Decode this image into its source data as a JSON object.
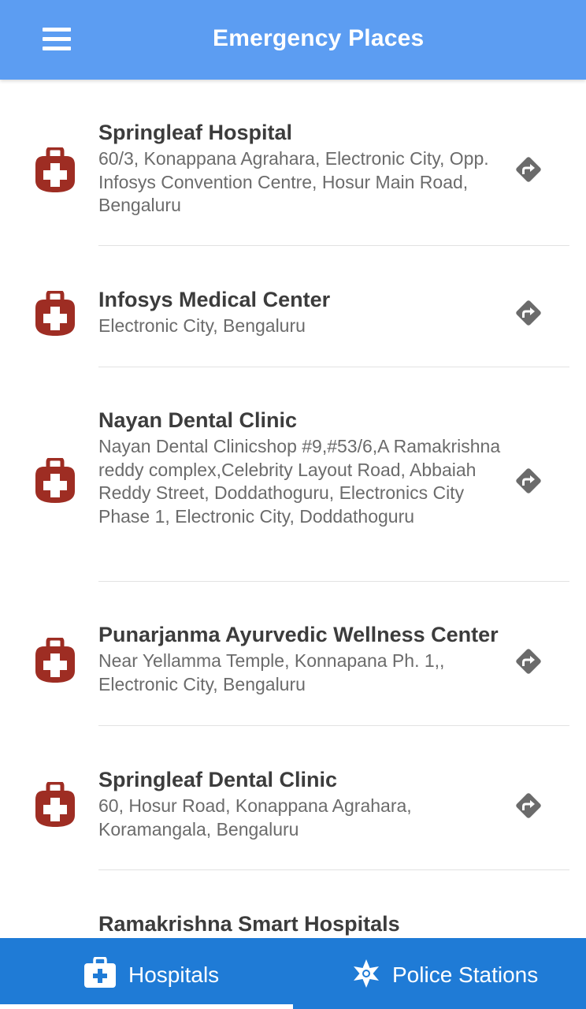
{
  "header": {
    "title": "Emergency Places",
    "menu_icon": "hamburger-menu-icon",
    "background_color": "#5c9df2"
  },
  "places": [
    {
      "name": "Springleaf Hospital",
      "address": "60/3, Konappana Agrahara, Electronic City, Opp. Infosys Convention Centre, Hosur Main Road, Bengaluru",
      "icon": "hospital-icon",
      "action_icon": "directions-icon"
    },
    {
      "name": "Infosys Medical Center",
      "address": "Electronic City, Bengaluru",
      "icon": "hospital-icon",
      "action_icon": "directions-icon"
    },
    {
      "name": "Nayan Dental Clinic",
      "address": "Nayan Dental Clinicshop #9,#53/6,A Ramakrishna reddy complex,Celebrity Layout Road, Abbaiah Reddy Street, Doddathoguru, Electronics City Phase 1, Electronic City, Doddathoguru",
      "icon": "hospital-icon",
      "action_icon": "directions-icon"
    },
    {
      "name": "Punarjanma Ayurvedic Wellness Center",
      "address": "Near Yellamma Temple, Konnapana Ph. 1,, Electronic City, Bengaluru",
      "icon": "hospital-icon",
      "action_icon": "directions-icon"
    },
    {
      "name": "Springleaf Dental Clinic",
      "address": "60, Hosur Road, Konappana Agrahara, Koramangala, Bengaluru",
      "icon": "hospital-icon",
      "action_icon": "directions-icon"
    },
    {
      "name": "Ramakrishna Smart Hospitals",
      "address": "",
      "icon": "hospital-icon",
      "action_icon": "directions-icon"
    }
  ],
  "bottom_nav": {
    "tabs": [
      {
        "label": "Hospitals",
        "icon": "medical-kit-icon",
        "selected": true
      },
      {
        "label": "Police Stations",
        "icon": "police-badge-icon",
        "selected": false
      }
    ],
    "background_color": "#1f7bd6"
  },
  "colors": {
    "hospital_icon": "#9e2d23",
    "directions_icon": "#6b6b6b"
  }
}
